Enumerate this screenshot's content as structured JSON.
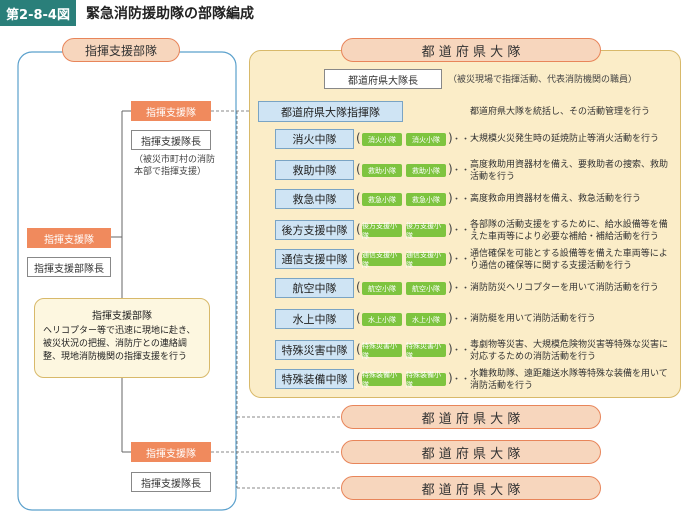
{
  "header": {
    "figure_number": "第2-8-4図",
    "title": "緊急消防援助隊の部隊編成"
  },
  "left": {
    "command_unit_title": "指揮支援部隊",
    "support_unit_1": "指揮支援隊",
    "leader_1": "指揮支援隊長",
    "leader_1_note": "（被災市町村の消防本部で指揮支援）",
    "support_unit_2": "指揮支援隊",
    "unit_leader": "指揮支援部隊長",
    "description_title": "指揮支援部隊",
    "description": "ヘリコプター等で迅速に現地に赴き、被災状況の把握、消防庁との連絡調整、現地消防機関の指揮支援を行う",
    "support_unit_3": "指揮支援隊",
    "leader_3": "指揮支援隊長"
  },
  "right": {
    "prefecture_unit": "都 道 府 県 大 隊",
    "prefecture_leader": "都道府県大隊長",
    "prefecture_leader_note": "（被災現場で指揮活動、代表消防機関の職員）",
    "command_team": "都道府県大隊指揮隊",
    "command_team_desc": "都道府県大隊を統括し、その活動管理を行う",
    "ellipsis": "・・・",
    "teams": [
      {
        "name": "消火中隊",
        "small": "消火小隊",
        "desc": "大規模火災発生時の延焼防止等消火活動を行う"
      },
      {
        "name": "救助中隊",
        "small": "救助小隊",
        "desc": "高度救助用資器材を備え、要救助者の捜索、救助活動を行う"
      },
      {
        "name": "救急中隊",
        "small": "救急小隊",
        "desc": "高度救命用資器材を備え、救急活動を行う"
      },
      {
        "name": "後方支援中隊",
        "small": "後方支援小隊",
        "desc": "各部隊の活動支援をするために、給水設備等を備えた車両等により必要な補給・補給活動を行う"
      },
      {
        "name": "通信支援中隊",
        "small": "通信支援小隊",
        "desc": "通信確保を可能とする設備等を備えた車両等により通信の確保等に関する支援活動を行う"
      },
      {
        "name": "航空中隊",
        "small": "航空小隊",
        "desc": "消防防災ヘリコプターを用いて消防活動を行う"
      },
      {
        "name": "水上中隊",
        "small": "水上小隊",
        "desc": "消防艇を用いて消防活動を行う"
      },
      {
        "name": "特殊災害中隊",
        "small": "特殊災害小隊",
        "desc": "毒劇物等災害、大規模危険物災害等特殊な災害に対応するための消防活動を行う"
      },
      {
        "name": "特殊装備中隊",
        "small": "特殊装備小隊",
        "desc": "水難救助隊、遠距離送水隊等特殊な装備を用いて消防活動を行う"
      }
    ],
    "extra_units": [
      "都 道 府 県 大 隊",
      "都 道 府 県 大 隊",
      "都 道 府 県 大 隊"
    ]
  }
}
